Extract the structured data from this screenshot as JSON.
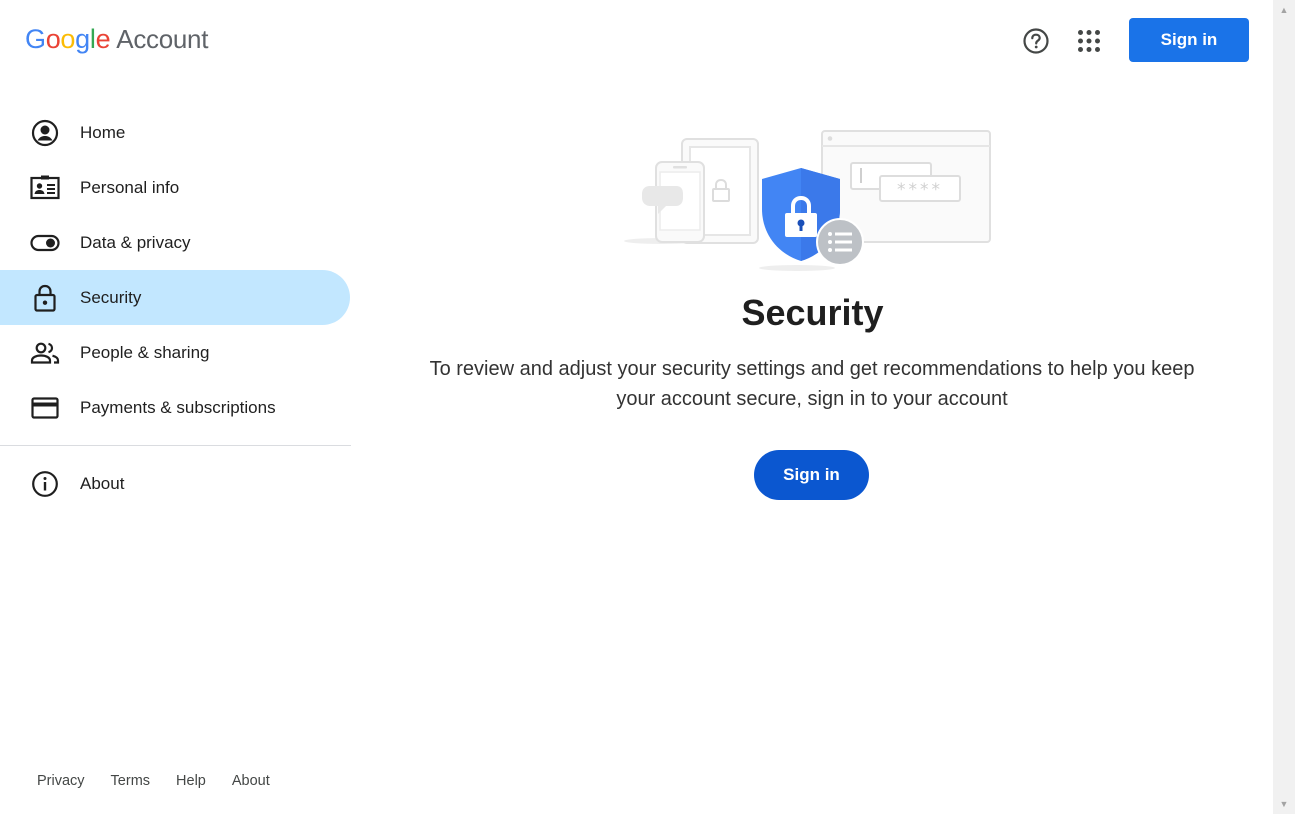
{
  "header": {
    "logo": {
      "letters": [
        "G",
        "o",
        "o",
        "g",
        "l",
        "e"
      ],
      "product": "Account"
    },
    "help_icon": "help-circle-icon",
    "apps_icon": "apps-grid-icon",
    "signin_label": "Sign in"
  },
  "sidebar": {
    "items": [
      {
        "label": "Home",
        "icon": "account-circle-icon"
      },
      {
        "label": "Personal info",
        "icon": "id-card-icon"
      },
      {
        "label": "Data & privacy",
        "icon": "toggle-icon"
      },
      {
        "label": "Security",
        "icon": "lock-icon",
        "active": true
      },
      {
        "label": "People & sharing",
        "icon": "people-icon"
      },
      {
        "label": "Payments & subscriptions",
        "icon": "credit-card-icon"
      }
    ],
    "about": {
      "label": "About",
      "icon": "info-icon"
    }
  },
  "main": {
    "title": "Security",
    "description": "To review and adjust your security settings and get recommendations to help you keep your account secure, sign in to your account",
    "signin_label": "Sign in",
    "illustration_password_mask": "****"
  },
  "footer": {
    "links": [
      "Privacy",
      "Terms",
      "Help",
      "About"
    ]
  },
  "colors": {
    "primary": "#1a73e8",
    "primary_dark": "#0b57d0",
    "active_nav": "#c2e7ff",
    "shield": "#4285F4"
  }
}
